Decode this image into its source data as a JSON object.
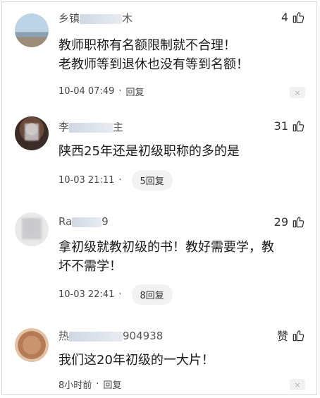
{
  "comments": [
    {
      "username": "乡镇",
      "username_tail": "木",
      "likes": "4",
      "text_lines": [
        "教师职称有名额限制就不合理！",
        "老教师等到退休也没有等到名额！"
      ],
      "date": "10-04 07:49",
      "separator": "·",
      "reply": "回复",
      "close": "×"
    },
    {
      "username": "李",
      "username_tail": "主",
      "likes": "31",
      "text_lines": [
        "陕西25年还是初级职称的多的是"
      ],
      "date": "10-03 21:11",
      "separator": "·",
      "reply": "5回复",
      "close": "×"
    },
    {
      "username": "Ra",
      "username_tail": "9",
      "likes": "29",
      "text_lines": [
        "拿初级就教初级的书！教好需要学，教",
        "坏不需学！"
      ],
      "date": "10-03 22:41",
      "separator": "·",
      "reply": "8回复",
      "close": "×"
    },
    {
      "username": "热",
      "username_tail": "904938",
      "likes": "赞",
      "text_lines": [
        "我们这20年初级的一大片！"
      ],
      "date": "8小时前",
      "separator": "·",
      "reply": "回复",
      "close": "×"
    }
  ]
}
